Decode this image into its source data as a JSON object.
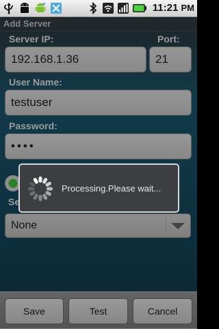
{
  "status_bar": {
    "time": "11:21",
    "ampm": "PM",
    "icons": [
      "usb-icon",
      "android-debug-icon",
      "green-android-icon",
      "app-notification-icon",
      "bluetooth-icon",
      "wifi-icon",
      "signal-icon",
      "battery-icon"
    ]
  },
  "title": "Add Server",
  "form": {
    "server_ip_label": "Server IP:",
    "server_ip_value": "192.168.1.36",
    "port_label": "Port:",
    "port_value": "21",
    "user_name_label": "User Name:",
    "user_name_value": "testuser",
    "password_label": "Password:",
    "password_value": "••••",
    "security_label_partial": "Se",
    "security_selected": "None"
  },
  "dialog": {
    "message": "Processing.Please wait..."
  },
  "buttons": {
    "save": "Save",
    "test": "Test",
    "cancel": "Cancel"
  },
  "colors": {
    "accent_green": "#3ec83e",
    "battery_green": "#4cd43c"
  }
}
